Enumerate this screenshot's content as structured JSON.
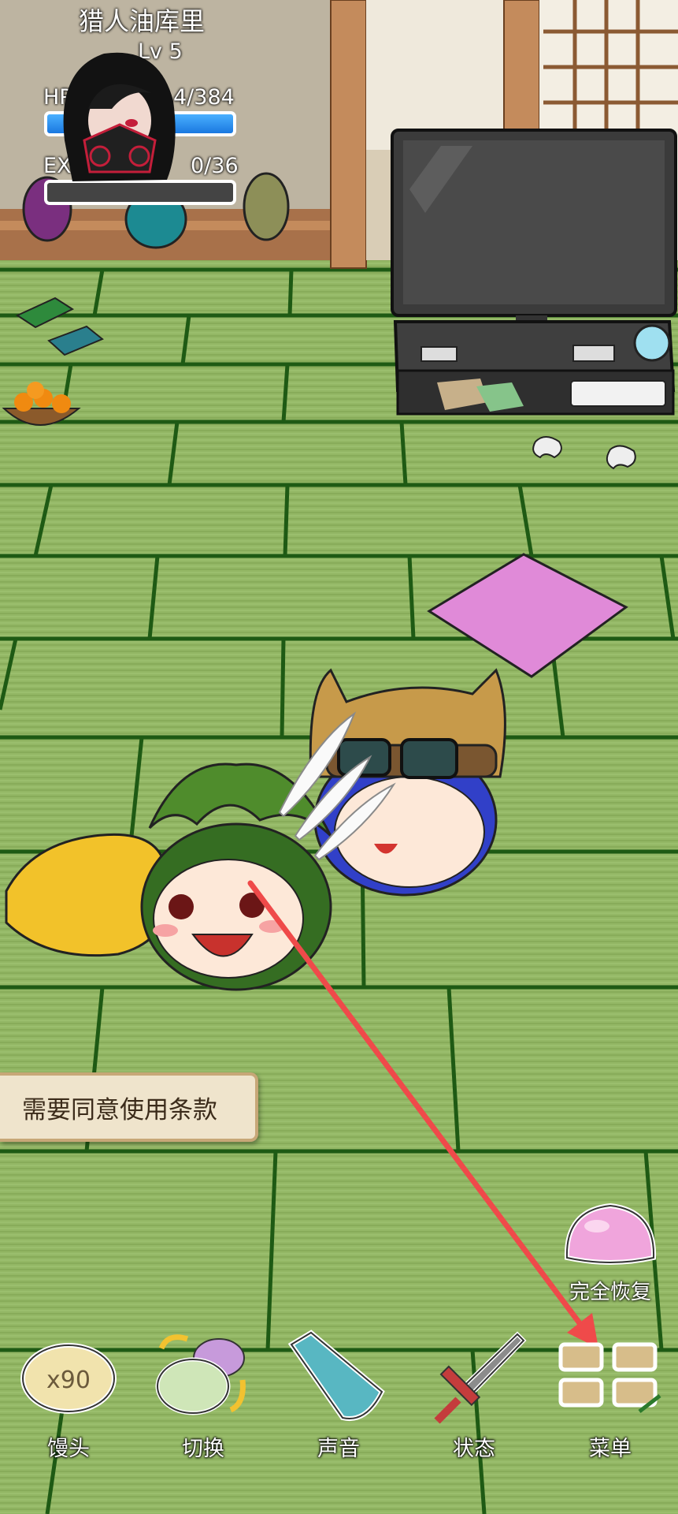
{
  "hud": {
    "player_name": "猎人油库里",
    "level": "Lv 5",
    "hp_label": "HP",
    "hp_value": "4/384",
    "exp_label": "EXP",
    "exp_value": "0/36"
  },
  "notice": {
    "terms_label": "需要同意使用条款"
  },
  "heal": {
    "label": "完全恢复",
    "icon": "pink-slime-icon"
  },
  "toolbar": {
    "items": [
      {
        "label": "馒头",
        "icon": "bun-icon",
        "badge": "x90"
      },
      {
        "label": "切换",
        "icon": "switch-icon"
      },
      {
        "label": "声音",
        "icon": "megaphone-icon"
      },
      {
        "label": "状态",
        "icon": "sword-icon"
      },
      {
        "label": "菜单",
        "icon": "menu-grid-icon"
      }
    ]
  }
}
